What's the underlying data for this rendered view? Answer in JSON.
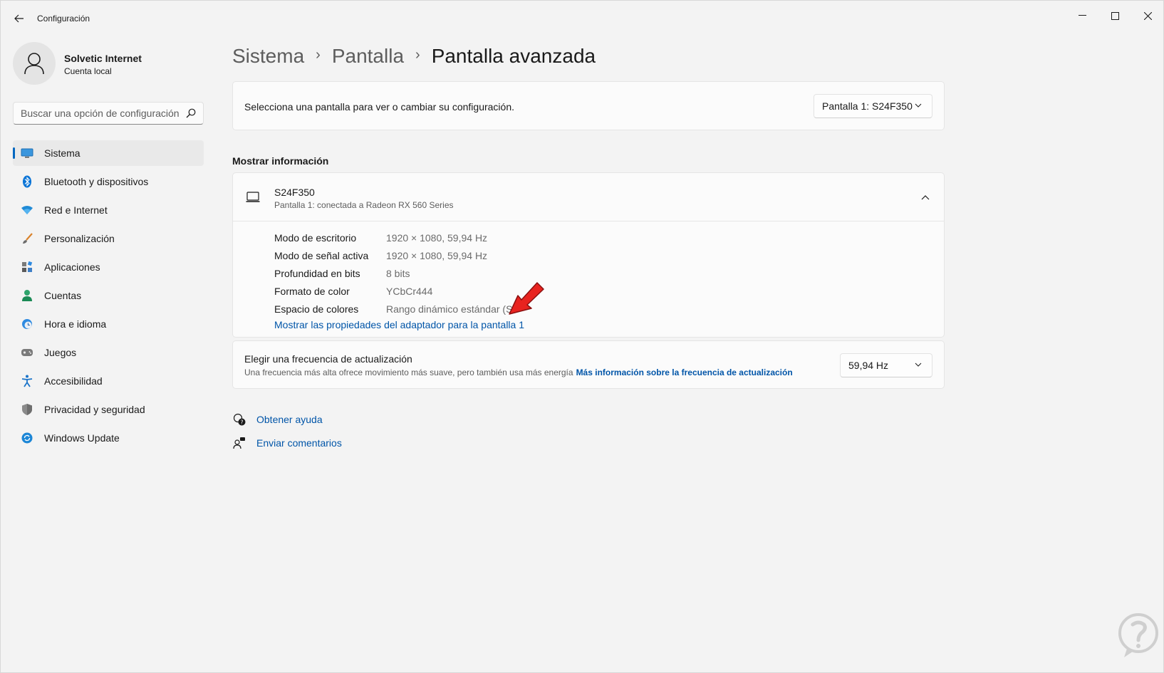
{
  "window": {
    "title": "Configuración",
    "back_label": "Atrás"
  },
  "profile": {
    "name": "Solvetic Internet",
    "account_type": "Cuenta local"
  },
  "search": {
    "placeholder": "Buscar una opción de configuración"
  },
  "nav": {
    "items": [
      {
        "label": "Sistema",
        "icon": "system-icon",
        "active": true
      },
      {
        "label": "Bluetooth y dispositivos",
        "icon": "bluetooth-icon"
      },
      {
        "label": "Red e Internet",
        "icon": "wifi-icon"
      },
      {
        "label": "Personalización",
        "icon": "brush-icon"
      },
      {
        "label": "Aplicaciones",
        "icon": "apps-icon"
      },
      {
        "label": "Cuentas",
        "icon": "person-icon"
      },
      {
        "label": "Hora e idioma",
        "icon": "clock-globe-icon"
      },
      {
        "label": "Juegos",
        "icon": "gamepad-icon"
      },
      {
        "label": "Accesibilidad",
        "icon": "accessibility-icon"
      },
      {
        "label": "Privacidad y seguridad",
        "icon": "shield-icon"
      },
      {
        "label": "Windows Update",
        "icon": "update-icon"
      }
    ]
  },
  "breadcrumb": {
    "items": [
      "Sistema",
      "Pantalla"
    ],
    "current": "Pantalla avanzada"
  },
  "display_select": {
    "prompt": "Selecciona una pantalla para ver o cambiar su configuración.",
    "selected": "Pantalla 1: S24F350"
  },
  "display_info": {
    "section_title": "Mostrar información",
    "device_name": "S24F350",
    "device_sub": "Pantalla 1: conectada a Radeon RX 560 Series",
    "rows": [
      {
        "key": "Modo de escritorio",
        "value": "1920 × 1080, 59,94 Hz"
      },
      {
        "key": "Modo de señal activa",
        "value": "1920 × 1080, 59,94 Hz"
      },
      {
        "key": "Profundidad en bits",
        "value": "8 bits"
      },
      {
        "key": "Formato de color",
        "value": "YCbCr444"
      },
      {
        "key": "Espacio de colores",
        "value": "Rango dinámico estándar (SD"
      }
    ],
    "adapter_link": "Mostrar las propiedades del adaptador para la pantalla 1"
  },
  "refresh_rate": {
    "title": "Elegir una frecuencia de actualización",
    "description": "Una frecuencia más alta ofrece movimiento más suave, pero también usa más energía",
    "link": "Más información sobre la frecuencia de actualización",
    "selected": "59,94 Hz"
  },
  "footer_links": {
    "help": "Obtener ayuda",
    "feedback": "Enviar comentarios"
  },
  "colors": {
    "accent": "#0067c0",
    "link": "#0055a8",
    "annotation_arrow": "#e8231f"
  }
}
